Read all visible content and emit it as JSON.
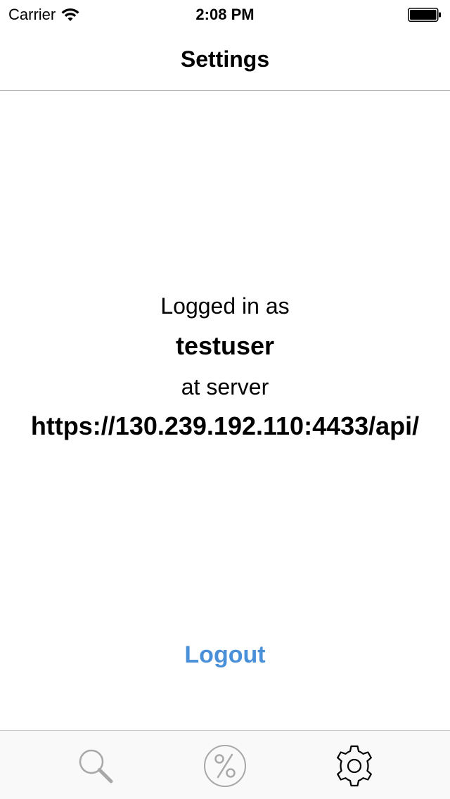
{
  "status_bar": {
    "carrier": "Carrier",
    "time": "2:08 PM",
    "wifi_icon": "wifi-icon",
    "battery_icon": "battery-icon"
  },
  "nav": {
    "title": "Settings"
  },
  "account": {
    "logged_in_label": "Logged in as",
    "username": "testuser",
    "at_server_label": "at server",
    "server_url": "https://130.239.192.110:4433/api/"
  },
  "actions": {
    "logout_label": "Logout"
  },
  "tab_bar": {
    "tabs": [
      {
        "icon": "search-icon",
        "selected": false
      },
      {
        "icon": "percent-icon",
        "selected": false
      },
      {
        "icon": "gear-icon",
        "selected": true
      }
    ]
  },
  "colors": {
    "accent": "#4a90d9",
    "tab_inactive": "#a8a8a8",
    "tab_active": "#000000"
  }
}
